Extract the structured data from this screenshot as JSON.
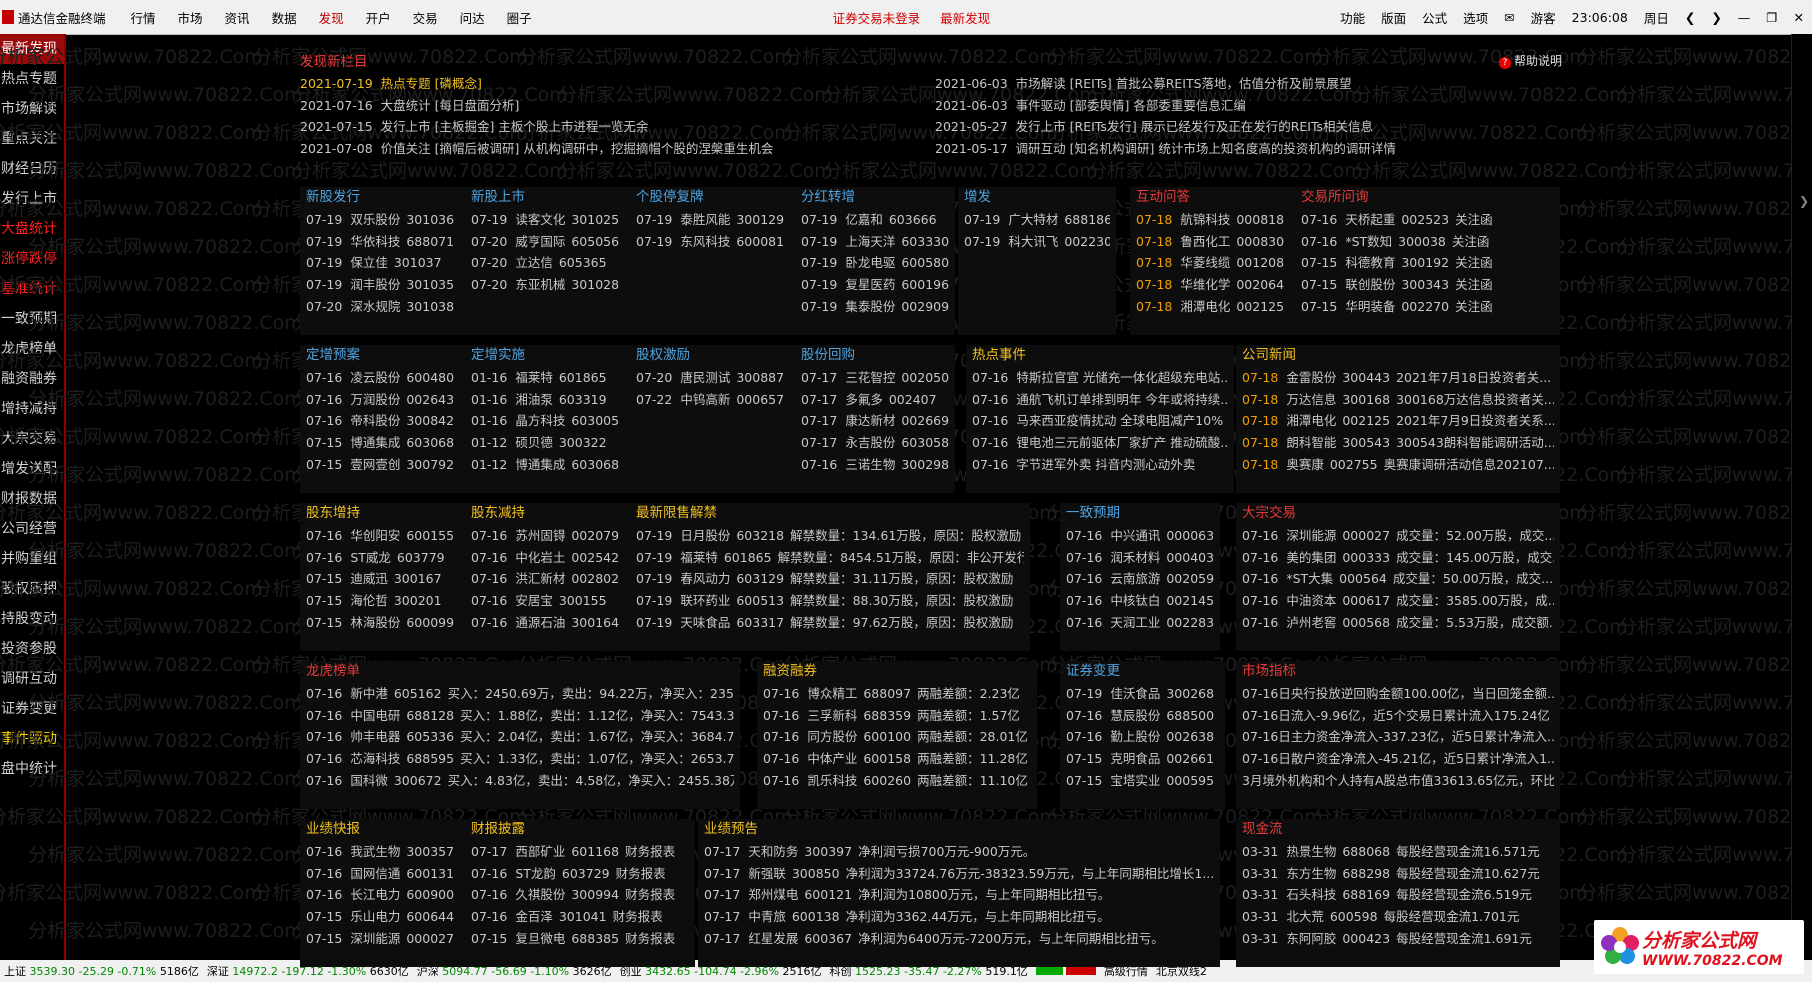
{
  "topbar": {
    "app_name": "通达信金融终端",
    "menus": [
      "行情",
      "市场",
      "资讯",
      "数据",
      "发现",
      "开户",
      "交易",
      "问达",
      "圈子"
    ],
    "active_menu": 4,
    "msgs": [
      "证券交易未登录",
      "最新发现"
    ],
    "right_items": [
      "功能",
      "版面",
      "公式",
      "选项",
      "游客",
      "23:06:08",
      "周日"
    ]
  },
  "sidebar": [
    {
      "label": "最新发现",
      "style": "selected"
    },
    {
      "label": "热点专题",
      "style": ""
    },
    {
      "label": "市场解读",
      "style": ""
    },
    {
      "label": "重点关注",
      "style": ""
    },
    {
      "label": "财经日历",
      "style": ""
    },
    {
      "label": "发行上市",
      "style": ""
    },
    {
      "label": "大盘统计",
      "style": "red"
    },
    {
      "label": "涨停跌停",
      "style": "red"
    },
    {
      "label": "基准统计",
      "style": "red"
    },
    {
      "label": "一致预期",
      "style": ""
    },
    {
      "label": "龙虎榜单",
      "style": ""
    },
    {
      "label": "融资融券",
      "style": ""
    },
    {
      "label": "增持减持",
      "style": ""
    },
    {
      "label": "大宗交易",
      "style": ""
    },
    {
      "label": "增发送配",
      "style": ""
    },
    {
      "label": "财报数据",
      "style": ""
    },
    {
      "label": "公司经营",
      "style": ""
    },
    {
      "label": "并购重组",
      "style": ""
    },
    {
      "label": "股权质押",
      "style": ""
    },
    {
      "label": "持股变动",
      "style": ""
    },
    {
      "label": "投资参股",
      "style": ""
    },
    {
      "label": "调研互动",
      "style": ""
    },
    {
      "label": "证券变更",
      "style": ""
    },
    {
      "label": "事件驱动",
      "style": "yellow"
    },
    {
      "label": "盘中统计",
      "style": ""
    }
  ],
  "discover": {
    "title": "发现新栏目",
    "help": "帮助说明",
    "left": [
      {
        "date": "2021-07-19",
        "text": "热点专题 [磷概念]",
        "hl": true
      },
      {
        "date": "2021-07-16",
        "text": "大盘统计 [每日盘面分析]",
        "hl": false
      },
      {
        "date": "2021-07-15",
        "text": "发行上市 [主板掘金]  主板个股上市进程一览无余",
        "hl": false
      },
      {
        "date": "2021-07-08",
        "text": "价值关注 [摘帽后被调研]  从机构调研中，挖掘摘帽个股的涅槃重生机会",
        "hl": false
      }
    ],
    "right": [
      {
        "date": "2021-06-03",
        "text": "市场解读 [REITs]  首批公募REITS落地，估值分析及前景展望"
      },
      {
        "date": "2021-06-03",
        "text": "事件驱动 [部委舆情]  各部委重要信息汇编"
      },
      {
        "date": "2021-05-27",
        "text": "发行上市 [REITs发行]  展示已经发行及正在发行的REITs相关信息"
      },
      {
        "date": "2021-05-17",
        "text": "调研互动 [知名机构调研]  统计市场上知名度高的投资机构的调研详情"
      }
    ]
  },
  "panels": {
    "xgfx": {
      "title": "新股发行",
      "rows": [
        [
          "07-19",
          "双乐股份",
          "301036"
        ],
        [
          "07-19",
          "华依科技",
          "688071"
        ],
        [
          "07-19",
          "保立佳",
          "301037"
        ],
        [
          "07-19",
          "润丰股份",
          "301035"
        ],
        [
          "07-20",
          "深水规院",
          "301038"
        ]
      ]
    },
    "xgss": {
      "title": "新股上市",
      "rows": [
        [
          "07-19",
          "读客文化",
          "301025"
        ],
        [
          "07-20",
          "威亨国际",
          "605056"
        ],
        [
          "07-20",
          "立达信",
          "605365"
        ],
        [
          "07-20",
          "东亚机械",
          "301028"
        ]
      ]
    },
    "tfp": {
      "title": "个股停复牌",
      "rows": [
        [
          "07-19",
          "泰胜风能",
          "300129"
        ],
        [
          "07-19",
          "东风科技",
          "600081"
        ]
      ]
    },
    "fhzz": {
      "title": "分红转增",
      "rows": [
        [
          "07-19",
          "亿嘉和",
          "603666"
        ],
        [
          "07-19",
          "上海天洋",
          "603330"
        ],
        [
          "07-19",
          "卧龙电驱",
          "600580"
        ],
        [
          "07-19",
          "复星医药",
          "600196"
        ],
        [
          "07-19",
          "集泰股份",
          "002909"
        ]
      ]
    },
    "zf": {
      "title": "增发",
      "rows": [
        [
          "07-19",
          "广大特材",
          "688186"
        ],
        [
          "07-19",
          "科大讯飞",
          "002230"
        ]
      ]
    },
    "hdwd": {
      "title": "互动问答",
      "rows": [
        [
          "07-18",
          "航锦科技",
          "000818"
        ],
        [
          "07-18",
          "鲁西化工",
          "000830"
        ],
        [
          "07-18",
          "华菱线缆",
          "001208"
        ],
        [
          "07-18",
          "华维化学",
          "002064"
        ],
        [
          "07-18",
          "湘潭电化",
          "002125"
        ]
      ]
    },
    "jyswd": {
      "title": "交易所问询",
      "rows": [
        [
          "07-16",
          "天桥起重",
          "002523",
          "关注函"
        ],
        [
          "07-16",
          "*ST数知",
          "300038",
          "关注函"
        ],
        [
          "07-15",
          "科德教育",
          "300192",
          "关注函"
        ],
        [
          "07-15",
          "联创股份",
          "300343",
          "关注函"
        ],
        [
          "07-15",
          "华明装备",
          "002270",
          "关注函"
        ]
      ]
    },
    "zzya": {
      "title": "定增预案",
      "rows": [
        [
          "07-16",
          "凌云股份",
          "600480"
        ],
        [
          "07-16",
          "万润股份",
          "002643"
        ],
        [
          "07-16",
          "帝科股份",
          "300842"
        ],
        [
          "07-15",
          "博通集成",
          "603068"
        ],
        [
          "07-15",
          "壹网壹创",
          "300792"
        ]
      ]
    },
    "zzss": {
      "title": "定增实施",
      "rows": [
        [
          "01-16",
          "福莱特",
          "601865"
        ],
        [
          "01-16",
          "湘油泵",
          "603319"
        ],
        [
          "01-16",
          "晶方科技",
          "603005"
        ],
        [
          "01-12",
          "硕贝德",
          "300322"
        ],
        [
          "01-12",
          "博通集成",
          "603068"
        ]
      ]
    },
    "gqjl": {
      "title": "股权激励",
      "rows": [
        [
          "07-20",
          "唐民测试",
          "300887"
        ],
        [
          "07-22",
          "中钨高新",
          "000657"
        ]
      ]
    },
    "gfhg": {
      "title": "股份回购",
      "rows": [
        [
          "07-17",
          "三花智控",
          "002050"
        ],
        [
          "07-17",
          "多氟多",
          "002407"
        ],
        [
          "07-17",
          "康达新材",
          "002669"
        ],
        [
          "07-17",
          "永吉股份",
          "603058"
        ],
        [
          "07-16",
          "三诺生物",
          "300298"
        ]
      ]
    },
    "rdsj": {
      "title": "热点事件",
      "rows": [
        [
          "07-16",
          "特斯拉官宣 光储充一体化超级充电站..."
        ],
        [
          "07-16",
          "通航飞机订单排到明年 今年或将持续..."
        ],
        [
          "07-16",
          "马来西亚疫情扰动 全球电阻减产10%"
        ],
        [
          "07-16",
          "锂电池三元前驱体厂家扩产 推动硫酸..."
        ],
        [
          "07-16",
          "字节进军外卖 抖音内测心动外卖"
        ]
      ]
    },
    "gsxw": {
      "title": "公司新闻",
      "rows": [
        [
          "07-18",
          "金雷股份",
          "300443",
          "2021年7月18日投资者关..."
        ],
        [
          "07-18",
          "万达信息",
          "300168",
          "300168万达信息投资者关..."
        ],
        [
          "07-18",
          "湘潭电化",
          "002125",
          "2021年7月9日投资者关系..."
        ],
        [
          "07-18",
          "朗科智能",
          "300543",
          "300543朗科智能调研活动..."
        ],
        [
          "07-18",
          "奥赛康",
          "002755",
          "奥赛康调研活动信息202107..."
        ]
      ]
    },
    "gdzc": {
      "title": "股东增持",
      "rows": [
        [
          "07-16",
          "华创阳安",
          "600155"
        ],
        [
          "07-16",
          "ST威龙",
          "603779"
        ],
        [
          "07-15",
          "迪威迅",
          "300167"
        ],
        [
          "07-15",
          "海伦哲",
          "300201"
        ],
        [
          "07-15",
          "林海股份",
          "600099"
        ]
      ]
    },
    "gdjc": {
      "title": "股东减持",
      "rows": [
        [
          "07-16",
          "苏州固锝",
          "002079"
        ],
        [
          "07-16",
          "中化岩土",
          "002542"
        ],
        [
          "07-16",
          "洪汇新材",
          "002802"
        ],
        [
          "07-16",
          "安居宝",
          "300155"
        ],
        [
          "07-16",
          "通源石油",
          "300164"
        ]
      ]
    },
    "xsjj": {
      "title": "最新限售解禁",
      "rows": [
        [
          "07-19",
          "日月股份",
          "603218",
          "解禁数量：134.61万股，原因：股权激励"
        ],
        [
          "07-19",
          "福莱特",
          "601865",
          "解禁数量：8454.51万股，原因：非公开发行"
        ],
        [
          "07-19",
          "春风动力",
          "603129",
          "解禁数量：31.11万股，原因：股权激励"
        ],
        [
          "07-19",
          "联环药业",
          "600513",
          "解禁数量：88.30万股，原因：股权激励"
        ],
        [
          "07-19",
          "天味食品",
          "603317",
          "解禁数量：97.62万股，原因：股权激励"
        ]
      ]
    },
    "yzyq": {
      "title": "一致预期",
      "rows": [
        [
          "07-16",
          "中兴通讯",
          "000063"
        ],
        [
          "07-16",
          "润禾材料",
          "000403"
        ],
        [
          "07-16",
          "云南旅游",
          "002059"
        ],
        [
          "07-16",
          "中核钛白",
          "002145"
        ],
        [
          "07-16",
          "天润工业",
          "002283"
        ]
      ]
    },
    "dzjy": {
      "title": "大宗交易",
      "rows": [
        [
          "07-16",
          "深圳能源",
          "000027",
          "成交量：52.00万股，成交..."
        ],
        [
          "07-16",
          "美的集团",
          "000333",
          "成交量：145.00万股，成交..."
        ],
        [
          "07-16",
          "*ST大集",
          "000564",
          "成交量：50.00万股，成交..."
        ],
        [
          "07-16",
          "中油资本",
          "000617",
          "成交量：3585.00万股，成..."
        ],
        [
          "07-16",
          "泸州老窖",
          "000568",
          "成交量：5.53万股，成交额..."
        ]
      ]
    },
    "lhb": {
      "title": "龙虎榜单",
      "rows": [
        [
          "07-16",
          "新中港",
          "605162",
          "买入：2450.69万，卖出：94.22万，净买入：235..."
        ],
        [
          "07-16",
          "中国电研",
          "688128",
          "买入：1.88亿，卖出：1.12亿，净买入：7543.37..."
        ],
        [
          "07-16",
          "帅丰电器",
          "605336",
          "买入：2.04亿，卖出：1.67亿，净买入：3684.70..."
        ],
        [
          "07-16",
          "芯海科技",
          "688595",
          "买入：1.33亿，卖出：1.07亿，净买入：2653.76..."
        ],
        [
          "07-16",
          "国科微",
          "300672",
          "买入：4.83亿，卖出：4.58亿，净买入：2455.38万"
        ]
      ]
    },
    "rzrq": {
      "title": "融资融券",
      "rows": [
        [
          "07-16",
          "博众精工",
          "688097",
          "两融差额：2.23亿"
        ],
        [
          "07-16",
          "三孚新科",
          "688359",
          "两融差额：1.57亿"
        ],
        [
          "07-16",
          "同方股份",
          "600100",
          "两融差额：28.01亿"
        ],
        [
          "07-16",
          "中体产业",
          "600158",
          "两融差额：11.28亿"
        ],
        [
          "07-16",
          "凯乐科技",
          "600260",
          "两融差额：11.10亿"
        ]
      ]
    },
    "zqbg": {
      "title": "证券变更",
      "rows": [
        [
          "07-19",
          "佳沃食品",
          "300268"
        ],
        [
          "07-16",
          "慧辰股份",
          "688500"
        ],
        [
          "07-16",
          "勤上股份",
          "002638"
        ],
        [
          "07-15",
          "克明食品",
          "002661"
        ],
        [
          "07-15",
          "宝塔实业",
          "000595"
        ]
      ]
    },
    "sczb": {
      "title": "市场指标",
      "rows": [
        [
          "07-16日央行投放逆回购金额100.00亿，当日回笼金额..."
        ],
        [
          "07-16日流入-9.96亿，近5个交易日累计流入175.24亿"
        ],
        [
          "07-16日主力资金净流入-337.23亿，近5日累计净流入..."
        ],
        [
          "07-16日散户资金净流入-45.21亿，近5日累计净流入1..."
        ],
        [
          "3月境外机构和个人持有A股总市值33613.65亿元，环比..."
        ]
      ]
    },
    "yjkb": {
      "title": "业绩快报",
      "rows": [
        [
          "07-16",
          "我武生物",
          "300357"
        ],
        [
          "07-16",
          "国网信通",
          "600131"
        ],
        [
          "07-16",
          "长江电力",
          "600900"
        ],
        [
          "07-15",
          "乐山电力",
          "600644"
        ],
        [
          "07-15",
          "深圳能源",
          "000027"
        ]
      ]
    },
    "cbpl": {
      "title": "财报披露",
      "rows": [
        [
          "07-17",
          "西部矿业",
          "601168",
          "财务报表"
        ],
        [
          "07-16",
          "ST龙韵",
          "603729",
          "财务报表"
        ],
        [
          "07-16",
          "久祺股份",
          "300994",
          "财务报表"
        ],
        [
          "07-16",
          "金百泽",
          "301041",
          "财务报表"
        ],
        [
          "07-15",
          "复旦微电",
          "688385",
          "财务报表"
        ]
      ]
    },
    "yjyg": {
      "title": "业绩预告",
      "rows": [
        [
          "07-17",
          "天和防务",
          "300397",
          "净利润亏损700万元-900万元。"
        ],
        [
          "07-17",
          "新强联",
          "300850",
          "净利润为33724.76万元-38323.59万元，与上年同期相比增长1..."
        ],
        [
          "07-17",
          "郑州煤电",
          "600121",
          "净利润为10800万元，与上年同期相比扭亏。"
        ],
        [
          "07-17",
          "中青旅",
          "600138",
          "净利润为3362.44万元，与上年同期相比扭亏。"
        ],
        [
          "07-17",
          "红星发展",
          "600367",
          "净利润为6400万元-7200万元，与上年同期相比扭亏。"
        ]
      ]
    },
    "xjl": {
      "title": "现金流",
      "rows": [
        [
          "03-31",
          "热景生物",
          "688068",
          "每股经营现金流16.571元"
        ],
        [
          "03-31",
          "东方生物",
          "688298",
          "每股经营现金流10.627元"
        ],
        [
          "03-31",
          "石头科技",
          "688169",
          "每股经营现金流6.519元"
        ],
        [
          "03-31",
          "北大荒",
          "600598",
          "每股经营现金流1.701元"
        ],
        [
          "03-31",
          "东阿阿胶",
          "000423",
          "每股经营现金流1.691元"
        ]
      ]
    }
  },
  "statusbar": [
    {
      "name": "上证",
      "val": "3539.30",
      "chg": "-25.29",
      "pct": "-0.71%",
      "amt": "5186亿"
    },
    {
      "name": "深证",
      "val": "14972.2",
      "chg": "-197.12",
      "pct": "-1.30%",
      "amt": "6630亿"
    },
    {
      "name": "沪深",
      "val": "5094.77",
      "chg": "-56.69",
      "pct": "-1.10%",
      "amt": "3626亿"
    },
    {
      "name": "创业",
      "val": "3432.65",
      "chg": "-104.74",
      "pct": "-2.96%",
      "amt": "2516亿"
    },
    {
      "name": "科创",
      "val": "1525.23",
      "chg": "-35.47",
      "pct": "-2.27%",
      "amt": "519.1亿"
    }
  ],
  "status_right": [
    "高级行情",
    "北京双线2"
  ],
  "brand": {
    "line1": "分析家公式网",
    "line2": "WWW.70822.COM"
  },
  "watermark": "分析家公式网www.70822.Com",
  "colors": {
    "accent_red": "#e83a3a",
    "title_blue": "#4ea3e0",
    "title_yellow": "#f0c020",
    "date_orange": "#f0a000",
    "selected_bg": "#9a0a0a"
  }
}
